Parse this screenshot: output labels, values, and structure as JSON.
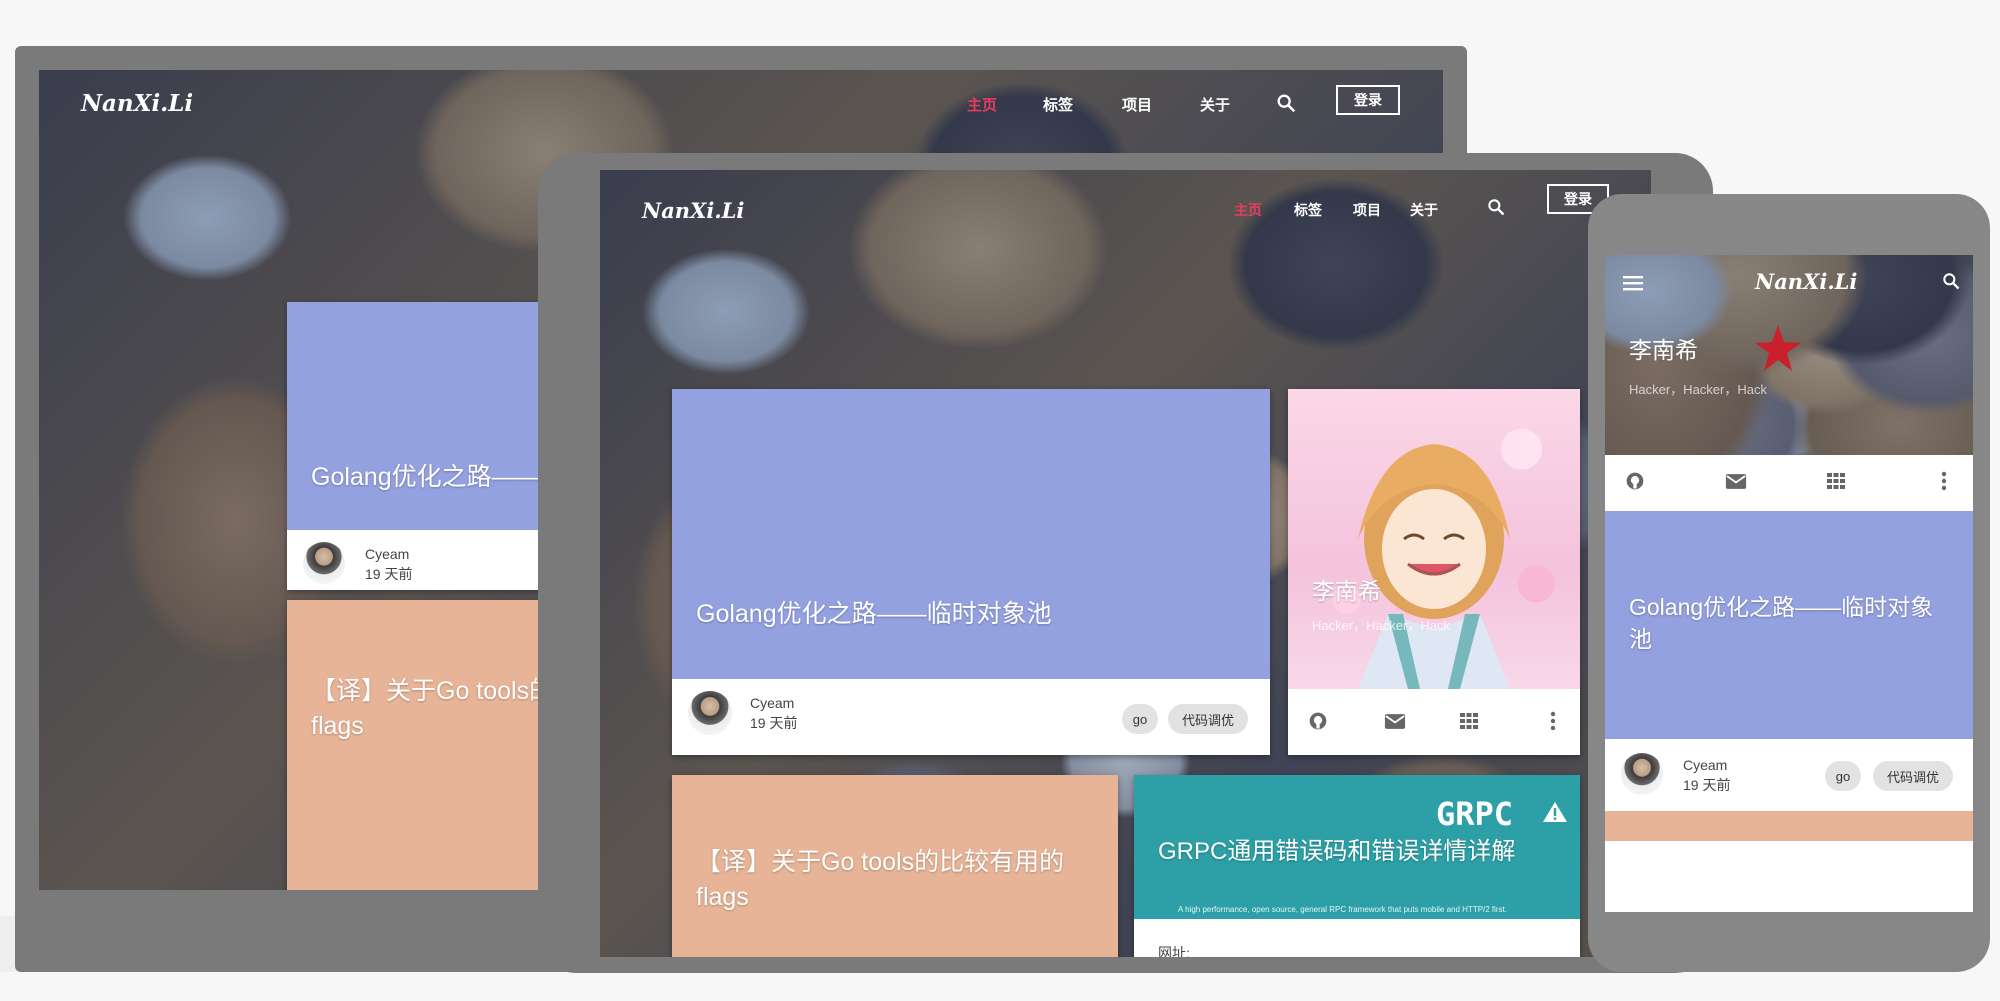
{
  "site": {
    "logo": "NanXi.Li",
    "nav": [
      "主页",
      "标签",
      "项目",
      "关于"
    ],
    "login": "登录"
  },
  "colors": {
    "accent": "#e63e5c",
    "card_blue": "#94a1e0",
    "card_peach": "#e7b497",
    "card_teal": "#2ca0a6"
  },
  "profile": {
    "name": "李南希",
    "bio": "Hacker，Hacker，Hack",
    "icons": [
      "github-icon",
      "mail-icon",
      "apps-grid-icon",
      "more-vert-icon"
    ]
  },
  "posts": [
    {
      "title": "Golang优化之路——临时对象池",
      "author": "Cyeam",
      "time": "19 天前",
      "tags": [
        "go",
        "代码调优"
      ]
    },
    {
      "title": "【译】关于Go tools的比较有用的flags",
      "title_short": "【译】关于Go tools的",
      "title_short_line2": "flags"
    },
    {
      "title": "GRPC通用错误码和错误详情详解",
      "logo_text": "GRPC",
      "tagline": "A high performance, open source, general RPC framework that puts mobile and HTTP/2 first.",
      "meta_label": "网址:"
    }
  ]
}
